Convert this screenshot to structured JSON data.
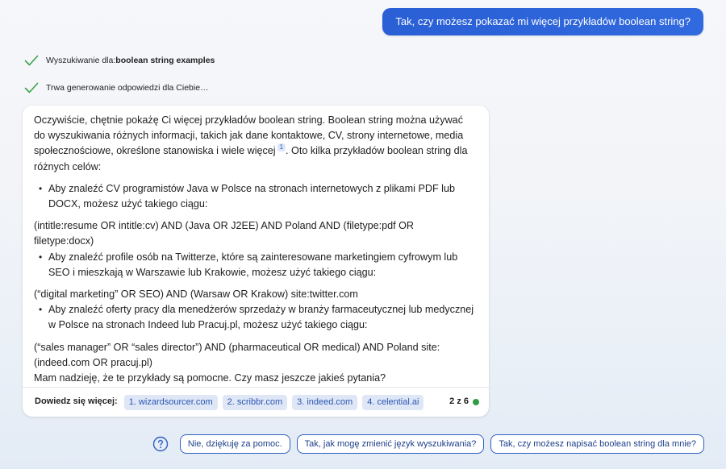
{
  "user_message": "Tak, czy możesz pokazać mi więcej przykładów boolean string?",
  "status": [
    {
      "prefix": "Wyszukiwanie dla: ",
      "bold": "boolean string examples"
    },
    {
      "prefix": "Trwa generowanie odpowiedzi dla Ciebie…",
      "bold": ""
    }
  ],
  "response": {
    "intro": "Oczywiście, chętnie pokażę Ci więcej przykładów boolean string. Boolean string można używać do wyszukiwania różnych informacji, takich jak dane kontaktowe, CV, strony internetowe, media społecznościowe, określone stanowiska i wiele więcej",
    "intro_sup": "1",
    "intro_tail": ". Oto kilka przykładów boolean string dla różnych celów:",
    "bullets": [
      "Aby znaleźć CV programistów Java w Polsce na stronach internetowych z plikami PDF lub DOCX, możesz użyć takiego ciągu:",
      "Aby znaleźć profile osób na Twitterze, które są zainteresowane marketingiem cyfrowym lub SEO i mieszkają w Warszawie lub Krakowie, możesz użyć takiego ciągu:",
      "Aby znaleźć oferty pracy dla menedżerów sprzedaży w branży farmaceutycznej lub medycznej w Polsce na stronach Indeed lub Pracuj.pl, możesz użyć takiego ciągu:"
    ],
    "codes": [
      "(intitle:resume OR intitle:cv) AND (Java OR J2EE) AND Poland AND (filetype:pdf OR filetype:docx)",
      "(“digital marketing” OR SEO) AND (Warsaw OR Krakow) site:twitter.com",
      "(“sales manager” OR “sales director”) AND (pharmaceutical OR medical) AND Poland site:(indeed.com OR pracuj.pl)"
    ],
    "closing": "Mam nadzieję, że te przykłady są pomocne. Czy masz jeszcze jakieś pytania?"
  },
  "footer": {
    "learn_more": "Dowiedz się więcej:",
    "links": [
      "1. wizardsourcer.com",
      "2. scribbr.com",
      "3. indeed.com",
      "4. celential.ai"
    ],
    "counter": "2 z 6",
    "counter_color": "#2e9e44"
  },
  "suggestions": [
    "Nie, dziękuję za pomoc.",
    "Tak, jak mogę zmienić język wyszukiwania?",
    "Tak, czy możesz napisać boolean string dla mnie?"
  ],
  "icons": {
    "check": "check-icon",
    "help": "question-circle-icon"
  },
  "colors": {
    "accent": "#2d64d8",
    "check": "#3aa24a",
    "link_bg": "#dfe7f7"
  }
}
